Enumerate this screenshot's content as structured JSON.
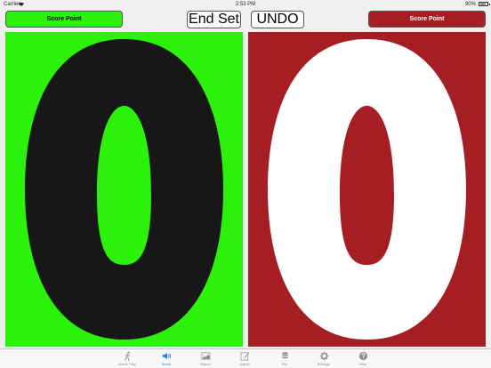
{
  "status_bar": {
    "carrier": "Carrier",
    "time": "2:53 PM",
    "battery": "90%",
    "battery_level": 0.9
  },
  "toolbar": {
    "left_score_label": "Score Point",
    "right_score_label": "Score Point",
    "end_set_label": "End Set",
    "undo_label": "UNDO"
  },
  "scores": {
    "left": "0",
    "right": "0"
  },
  "colors": {
    "left_team": "#2bf10b",
    "right_team": "#a51e24",
    "left_digit": "#171717",
    "right_digit": "#ffffff",
    "active_tab": "#1a7cf0"
  },
  "tab_bar": {
    "items": [
      {
        "label": "Game Play",
        "icon": "runner-icon",
        "active": false
      },
      {
        "label": "Score",
        "icon": "speaker-icon",
        "active": true
      },
      {
        "label": "Report",
        "icon": "chart-icon",
        "active": false
      },
      {
        "label": "Adjust",
        "icon": "edit-icon",
        "active": false
      },
      {
        "label": "File",
        "icon": "database-icon",
        "active": false
      },
      {
        "label": "Settings",
        "icon": "gear-icon",
        "active": false
      },
      {
        "label": "Help",
        "icon": "help-icon",
        "active": false
      }
    ]
  }
}
